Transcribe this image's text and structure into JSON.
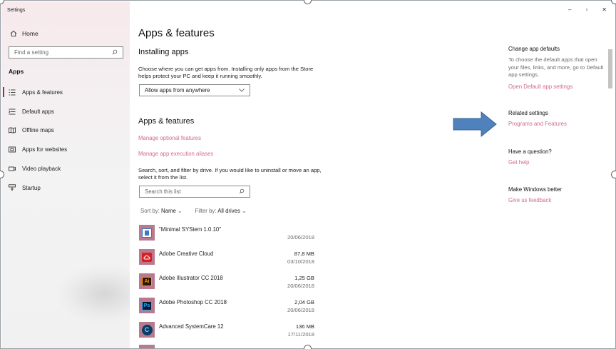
{
  "window": {
    "title": "Settings",
    "controls": [
      "–",
      "▫",
      "✕"
    ]
  },
  "sidebar": {
    "home_label": "Home",
    "search_placeholder": "Find a setting",
    "section_label": "Apps",
    "items": [
      {
        "label": "Apps & features",
        "icon": "apps-list-icon"
      },
      {
        "label": "Default apps",
        "icon": "default-apps-icon"
      },
      {
        "label": "Offline maps",
        "icon": "offline-maps-icon"
      },
      {
        "label": "Apps for websites",
        "icon": "apps-for-websites-icon"
      },
      {
        "label": "Video playback",
        "icon": "video-playback-icon"
      },
      {
        "label": "Startup",
        "icon": "startup-icon"
      }
    ]
  },
  "main": {
    "title": "Apps & features",
    "installing": {
      "heading": "Installing apps",
      "description": "Choose where you can get apps from. Installing only apps from the Store helps protect your PC and keep it running smoothly.",
      "dropdown_value": "Allow apps from anywhere"
    },
    "apps_features": {
      "heading": "Apps & features",
      "link_optional": "Manage optional features",
      "link_aliases": "Manage app execution aliases",
      "description": "Search, sort, and filter by drive. If you would like to uninstall or move an app, select it from the list.",
      "search_placeholder": "Search this list",
      "sort_label": "Sort by:",
      "sort_value": "Name",
      "filter_label": "Filter by:",
      "filter_value": "All drives"
    },
    "apps": [
      {
        "name": "\"Minimal SYStem 1.0.10\"",
        "size": "",
        "date": "20/06/2018",
        "icon": "minimal-system-icon"
      },
      {
        "name": "Adobe Creative Cloud",
        "size": "87,8 MB",
        "date": "03/10/2018",
        "icon": "adobe-creative-cloud-icon"
      },
      {
        "name": "Adobe Illustrator CC 2018",
        "size": "1,25 GB",
        "date": "20/06/2018",
        "icon": "adobe-illustrator-icon",
        "glyph": "Ai"
      },
      {
        "name": "Adobe Photoshop CC 2018",
        "size": "2,04 GB",
        "date": "20/06/2018",
        "icon": "adobe-photoshop-icon",
        "glyph": "Ps"
      },
      {
        "name": "Advanced SystemCare 12",
        "size": "136 MB",
        "date": "17/11/2018",
        "icon": "advanced-systemcare-icon",
        "glyph": "C"
      }
    ]
  },
  "right": {
    "defaults": {
      "heading": "Change app defaults",
      "description": "To choose the default apps that open your files, links, and more, go to Default app settings.",
      "link": "Open Default app settings"
    },
    "related": {
      "heading": "Related settings",
      "link": "Programs and Features"
    },
    "question": {
      "heading": "Have a question?",
      "link": "Get help"
    },
    "better": {
      "heading": "Make Windows better",
      "link": "Give us feedback"
    }
  },
  "colors": {
    "accent": "#c2185b",
    "link": "#d16d8a",
    "arrow": "#4f81bd"
  }
}
